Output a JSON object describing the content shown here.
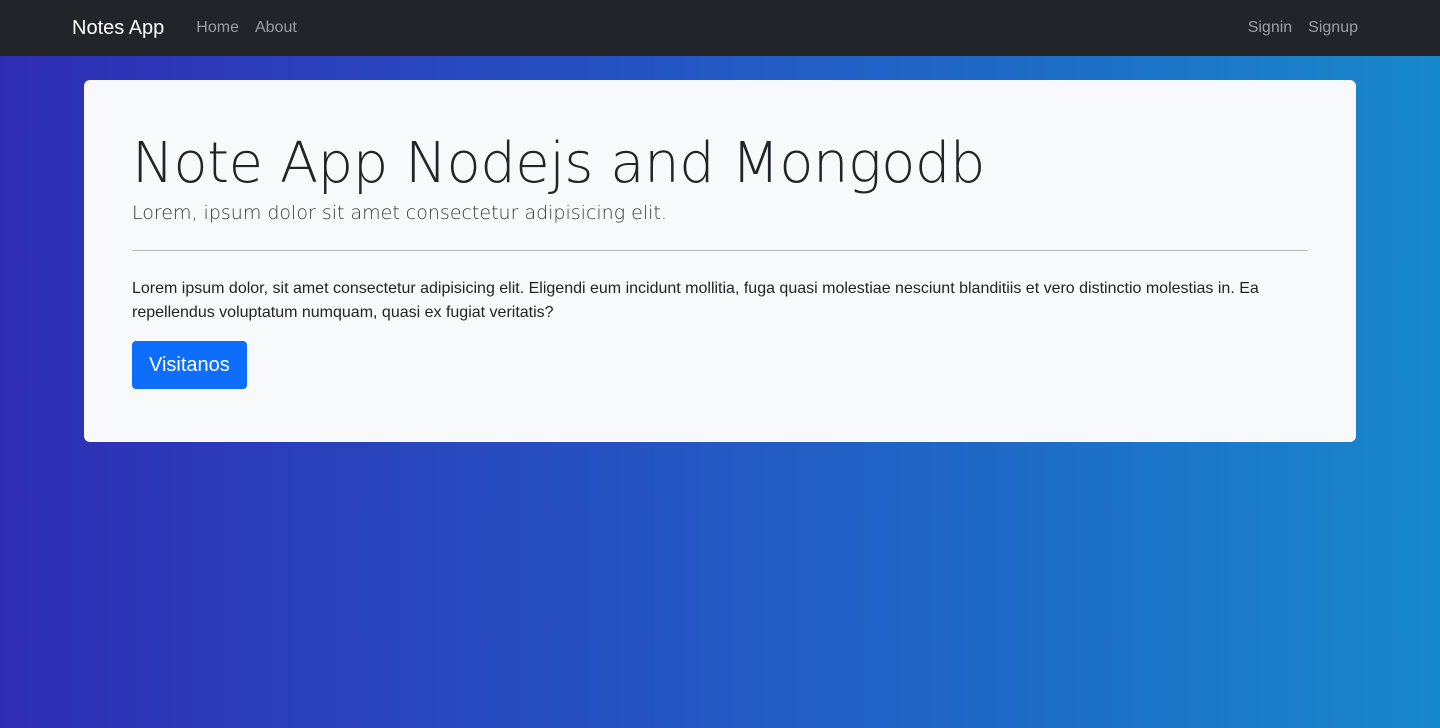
{
  "navbar": {
    "brand": "Notes App",
    "left_links": [
      "Home",
      "About"
    ],
    "right_links": [
      "Signin",
      "Signup"
    ]
  },
  "jumbotron": {
    "title": "Note App Nodejs and Mongodb",
    "lead": "Lorem, ipsum dolor sit amet consectetur adipisicing elit.",
    "body": "Lorem ipsum dolor, sit amet consectetur adipisicing elit. Eligendi eum incidunt mollitia, fuga quasi molestiae nesciunt blanditiis et vero distinctio molestias in. Ea repellendus voluptatum numquam, quasi ex fugiat veritatis?",
    "button_label": "Visitanos"
  },
  "colors": {
    "navbar_bg": "#212529",
    "card_bg": "#f8f9fa",
    "primary": "#0d6efd",
    "gradient_start": "#2f2db4",
    "gradient_end": "#1888cc"
  }
}
